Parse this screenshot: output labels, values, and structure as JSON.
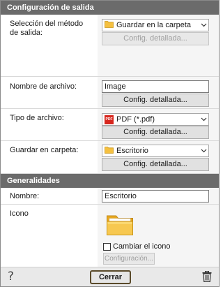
{
  "sections": {
    "output": "Configuración de salida",
    "general": "Generalidades"
  },
  "output_method": {
    "label": "Selección del método de salida:",
    "selected": "Guardar en la carpeta",
    "detail_button": "Config. detallada..."
  },
  "file_name": {
    "label": "Nombre de archivo:",
    "value": "Image",
    "detail_button": "Config. detallada..."
  },
  "file_type": {
    "label": "Tipo de archivo:",
    "selected": "PDF (*.pdf)",
    "detail_button": "Config. detallada..."
  },
  "save_folder": {
    "label": "Guardar en carpeta:",
    "selected": "Escritorio",
    "detail_button": "Config. detallada..."
  },
  "general": {
    "name_label": "Nombre:",
    "name_value": "Escritorio",
    "icon_label": "Icono",
    "change_icon_label": "Cambiar el icono",
    "change_icon_checked": false,
    "config_button": "Configuración..."
  },
  "footer": {
    "close_button": "Cerrar",
    "help_glyph": "?"
  },
  "icons": {
    "folder_color": "#f5c040",
    "pdf_color": "#d7261d"
  }
}
